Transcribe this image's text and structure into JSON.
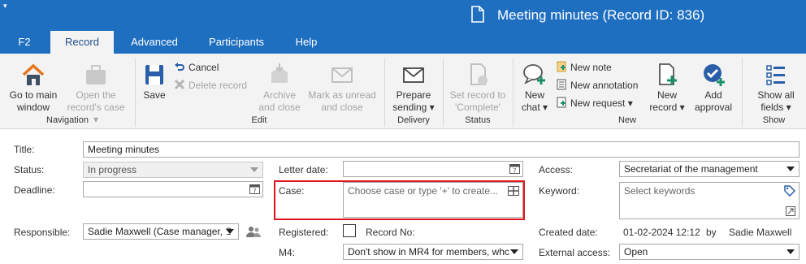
{
  "window": {
    "title": "Meeting minutes (Record ID: 836)",
    "qat_arrow": "▾"
  },
  "tabs": [
    {
      "label": "F2"
    },
    {
      "label": "Record"
    },
    {
      "label": "Advanced"
    },
    {
      "label": "Participants"
    },
    {
      "label": "Help"
    }
  ],
  "ribbon": {
    "navigation": {
      "group_label": "Navigation",
      "go_main_1": "Go to main",
      "go_main_2": "window",
      "open_case_1": "Open the",
      "open_case_2": "record's case ▾"
    },
    "edit": {
      "group_label": "Edit",
      "save": "Save",
      "cancel": "Cancel",
      "delete_record": "Delete record",
      "archive_1": "Archive",
      "archive_2": "and close",
      "mark_unread_1": "Mark as unread",
      "mark_unread_2": "and close"
    },
    "delivery": {
      "group_label": "Delivery",
      "prepare_1": "Prepare",
      "prepare_2": "sending ▾"
    },
    "status": {
      "group_label": "Status",
      "set_complete_1": "Set record to",
      "set_complete_2": "'Complete'"
    },
    "new": {
      "group_label": "New",
      "new_chat_1": "New",
      "new_chat_2": "chat ▾",
      "new_note": "New note",
      "new_annotation": "New annotation",
      "new_request": "New request ▾",
      "new_record_1": "New",
      "new_record_2": "record ▾",
      "add_approval_1": "Add",
      "add_approval_2": "approval"
    },
    "show": {
      "group_label": "Show",
      "show_all_1": "Show all",
      "show_all_2": "fields ▾"
    }
  },
  "form": {
    "title_label": "Title:",
    "title_value": "Meeting minutes",
    "status_label": "Status:",
    "status_value": "In progress",
    "deadline_label": "Deadline:",
    "deadline_value": "",
    "responsible_label": "Responsible:",
    "responsible_value": "Sadie Maxwell (Case manager, S",
    "letter_date_label": "Letter date:",
    "letter_date_value": "",
    "case_label": "Case:",
    "case_placeholder": "Choose case or type '+' to create...",
    "registered_label": "Registered:",
    "record_no_label": "Record No:",
    "m4_label": "M4:",
    "m4_value": "Don't show in MR4 for members, whc",
    "access_label": "Access:",
    "access_value": "Secretariat of the management",
    "keyword_label": "Keyword:",
    "keyword_placeholder": "Select keywords",
    "created_date_label": "Created date:",
    "created_date_value": "01-02-2024 12:12",
    "created_by_label": "by",
    "created_by_value": "Sadie Maxwell",
    "external_access_label": "External access:",
    "external_access_value": "Open",
    "calendar_day": "7"
  },
  "colors": {
    "accent": "#1f6fc0",
    "highlight": "#e0141e",
    "icon_blue": "#2a5ea8",
    "icon_teal": "#1a8f6a"
  }
}
